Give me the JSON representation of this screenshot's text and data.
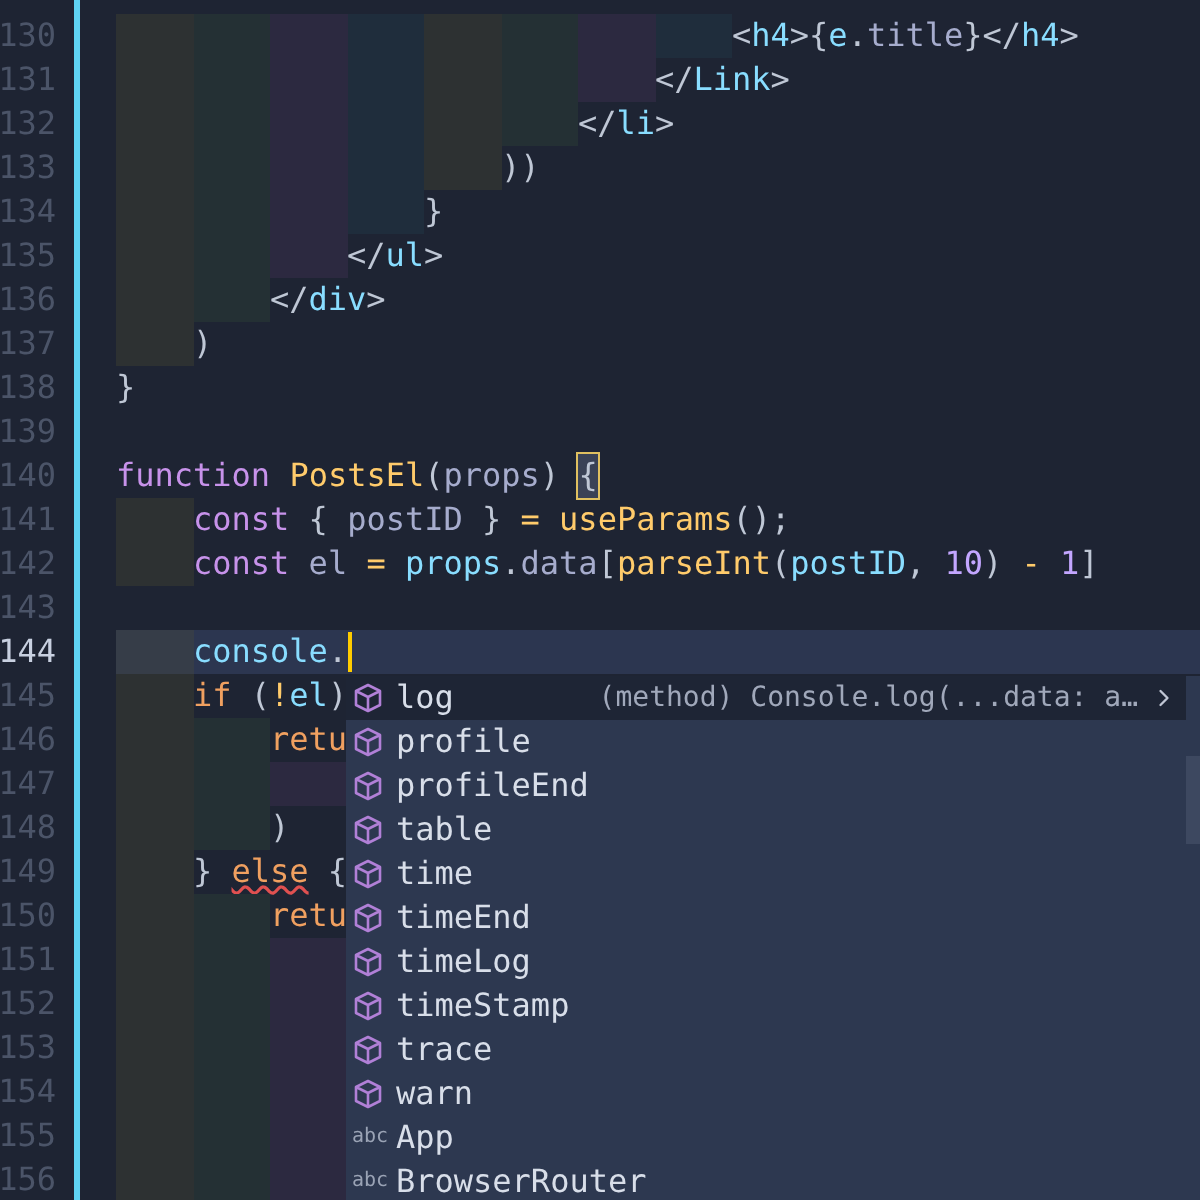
{
  "editor": {
    "lines": [
      {
        "number": "130",
        "guides": [
          {
            "color": "#2d3132"
          },
          {
            "color": "#243034"
          },
          {
            "color": "#2c2940"
          },
          {
            "color": "#1f2d3c"
          },
          {
            "color": "#2d3132"
          },
          {
            "color": "#243034"
          },
          {
            "color": "#2c2940"
          },
          {
            "color": "#1f2d3c"
          }
        ],
        "tokens": [
          {
            "kind": "punc",
            "text": "<"
          },
          {
            "kind": "tag",
            "text": "h4"
          },
          {
            "kind": "punc",
            "text": ">{"
          },
          {
            "kind": "var",
            "text": "e"
          },
          {
            "kind": "punc",
            "text": "."
          },
          {
            "kind": "prop",
            "text": "title"
          },
          {
            "kind": "punc",
            "text": "}</"
          },
          {
            "kind": "tag",
            "text": "h4"
          },
          {
            "kind": "punc",
            "text": ">"
          }
        ]
      },
      {
        "number": "131",
        "guides": [
          {
            "color": "#2d3132"
          },
          {
            "color": "#243034"
          },
          {
            "color": "#2c2940"
          },
          {
            "color": "#1f2d3c"
          },
          {
            "color": "#2d3132"
          },
          {
            "color": "#243034"
          },
          {
            "color": "#2c2940"
          }
        ],
        "tokens": [
          {
            "kind": "punc",
            "text": "</"
          },
          {
            "kind": "tag",
            "text": "Link"
          },
          {
            "kind": "punc",
            "text": ">"
          }
        ]
      },
      {
        "number": "132",
        "guides": [
          {
            "color": "#2d3132"
          },
          {
            "color": "#243034"
          },
          {
            "color": "#2c2940"
          },
          {
            "color": "#1f2d3c"
          },
          {
            "color": "#2d3132"
          },
          {
            "color": "#243034"
          }
        ],
        "tokens": [
          {
            "kind": "punc",
            "text": "</"
          },
          {
            "kind": "tag",
            "text": "li"
          },
          {
            "kind": "punc",
            "text": ">"
          }
        ]
      },
      {
        "number": "133",
        "guides": [
          {
            "color": "#2d3132"
          },
          {
            "color": "#243034"
          },
          {
            "color": "#2c2940"
          },
          {
            "color": "#1f2d3c"
          },
          {
            "color": "#2d3132"
          }
        ],
        "tokens": [
          {
            "kind": "punc",
            "text": "))"
          }
        ]
      },
      {
        "number": "134",
        "guides": [
          {
            "color": "#2d3132"
          },
          {
            "color": "#243034"
          },
          {
            "color": "#2c2940"
          },
          {
            "color": "#1f2d3c"
          }
        ],
        "tokens": [
          {
            "kind": "punc",
            "text": "}"
          }
        ]
      },
      {
        "number": "135",
        "guides": [
          {
            "color": "#2d3132"
          },
          {
            "color": "#243034"
          },
          {
            "color": "#2c2940"
          }
        ],
        "tokens": [
          {
            "kind": "punc",
            "text": "</"
          },
          {
            "kind": "tag",
            "text": "ul"
          },
          {
            "kind": "punc",
            "text": ">"
          }
        ]
      },
      {
        "number": "136",
        "guides": [
          {
            "color": "#2d3132"
          },
          {
            "color": "#243034"
          }
        ],
        "tokens": [
          {
            "kind": "punc",
            "text": "</"
          },
          {
            "kind": "tag",
            "text": "div"
          },
          {
            "kind": "punc",
            "text": ">"
          }
        ]
      },
      {
        "number": "137",
        "guides": [
          {
            "color": "#2d3132"
          }
        ],
        "tokens": [
          {
            "kind": "punc",
            "text": ")"
          }
        ]
      },
      {
        "number": "138",
        "tokens": [
          {
            "kind": "punc",
            "text": "}"
          }
        ]
      },
      {
        "number": "139"
      },
      {
        "number": "140",
        "tokens": [
          {
            "kind": "kw",
            "text": "function"
          },
          {
            "kind": "fn",
            "text": " PostsEl"
          },
          {
            "kind": "punc",
            "text": "("
          },
          {
            "kind": "prop",
            "text": "props"
          },
          {
            "kind": "punc",
            "text": ") "
          },
          {
            "kind": "punc",
            "text": "{",
            "matched": true
          }
        ]
      },
      {
        "number": "141",
        "guides": [
          {
            "color": "#2d3132"
          }
        ],
        "tokens": [
          {
            "kind": "kw",
            "text": "const"
          },
          {
            "kind": "punc",
            "text": " { "
          },
          {
            "kind": "prop",
            "text": "postID"
          },
          {
            "kind": "punc",
            "text": " } "
          },
          {
            "kind": "op",
            "text": "= "
          },
          {
            "kind": "fn",
            "text": "useParams"
          },
          {
            "kind": "punc",
            "text": "();"
          }
        ]
      },
      {
        "number": "142",
        "guides": [
          {
            "color": "#2d3132"
          }
        ],
        "tokens": [
          {
            "kind": "kw",
            "text": "const"
          },
          {
            "kind": "prop",
            "text": " el "
          },
          {
            "kind": "op",
            "text": "= "
          },
          {
            "kind": "var",
            "text": "props"
          },
          {
            "kind": "punc",
            "text": "."
          },
          {
            "kind": "prop",
            "text": "data"
          },
          {
            "kind": "punc",
            "text": "["
          },
          {
            "kind": "fn",
            "text": "parseInt"
          },
          {
            "kind": "punc",
            "text": "("
          },
          {
            "kind": "var",
            "text": "postID"
          },
          {
            "kind": "punc",
            "text": ", "
          },
          {
            "kind": "num",
            "text": "10"
          },
          {
            "kind": "punc",
            "text": ") "
          },
          {
            "kind": "op",
            "text": "- "
          },
          {
            "kind": "num",
            "text": "1"
          },
          {
            "kind": "punc",
            "text": "]"
          }
        ]
      },
      {
        "number": "143"
      },
      {
        "number": "144",
        "current": true,
        "cursor": true,
        "guides": [
          {
            "color": "#363d48"
          }
        ],
        "tokens": [
          {
            "kind": "var",
            "text": "console"
          },
          {
            "kind": "punc",
            "text": "."
          }
        ]
      },
      {
        "number": "145",
        "guides": [
          {
            "color": "#2d3132"
          }
        ],
        "tokens": [
          {
            "kind": "ctrl",
            "text": "if"
          },
          {
            "kind": "punc",
            "text": " ("
          },
          {
            "kind": "op",
            "text": "!"
          },
          {
            "kind": "var",
            "text": "el"
          },
          {
            "kind": "punc",
            "text": ")"
          }
        ]
      },
      {
        "number": "146",
        "guides": [
          {
            "color": "#2d3132"
          },
          {
            "color": "#243034"
          }
        ],
        "tokens": [
          {
            "kind": "ctrl",
            "text": "retu"
          }
        ]
      },
      {
        "number": "147",
        "guides": [
          {
            "color": "#2d3132"
          },
          {
            "color": "#243034"
          },
          {
            "color": "#2c2940"
          }
        ]
      },
      {
        "number": "148",
        "guides": [
          {
            "color": "#2d3132"
          },
          {
            "color": "#243034"
          }
        ],
        "tokens": [
          {
            "kind": "punc",
            "text": ")"
          }
        ]
      },
      {
        "number": "149",
        "guides": [
          {
            "color": "#2d3132"
          }
        ],
        "tokens": [
          {
            "kind": "punc",
            "text": "} "
          },
          {
            "kind": "ctrl",
            "text": "else",
            "squiggle": true
          },
          {
            "kind": "punc",
            "text": " {"
          }
        ]
      },
      {
        "number": "150",
        "guides": [
          {
            "color": "#2d3132"
          },
          {
            "color": "#243034"
          }
        ],
        "tokens": [
          {
            "kind": "ctrl",
            "text": "retu"
          }
        ]
      },
      {
        "number": "151",
        "guides": [
          {
            "color": "#2d3132"
          },
          {
            "color": "#243034"
          },
          {
            "color": "#2c2940"
          }
        ]
      },
      {
        "number": "152",
        "guides": [
          {
            "color": "#2d3132"
          },
          {
            "color": "#243034"
          },
          {
            "color": "#2c2940"
          }
        ]
      },
      {
        "number": "153",
        "guides": [
          {
            "color": "#2d3132"
          },
          {
            "color": "#243034"
          },
          {
            "color": "#2c2940"
          }
        ]
      },
      {
        "number": "154",
        "guides": [
          {
            "color": "#2d3132"
          },
          {
            "color": "#243034"
          },
          {
            "color": "#2c2940"
          }
        ]
      },
      {
        "number": "155",
        "guides": [
          {
            "color": "#2d3132"
          },
          {
            "color": "#243034"
          },
          {
            "color": "#2c2940"
          }
        ]
      },
      {
        "number": "156",
        "guides": [
          {
            "color": "#2d3132"
          },
          {
            "color": "#243034"
          },
          {
            "color": "#2c2940"
          }
        ]
      }
    ]
  },
  "suggestions": {
    "items": [
      {
        "kind": "method",
        "label": "log",
        "selected": true,
        "detail": "(method) Console.log(...data: a…"
      },
      {
        "kind": "method",
        "label": "profile",
        "selected": false
      },
      {
        "kind": "method",
        "label": "profileEnd",
        "selected": false
      },
      {
        "kind": "method",
        "label": "table",
        "selected": false
      },
      {
        "kind": "method",
        "label": "time",
        "selected": false
      },
      {
        "kind": "method",
        "label": "timeEnd",
        "selected": false
      },
      {
        "kind": "method",
        "label": "timeLog",
        "selected": false
      },
      {
        "kind": "method",
        "label": "timeStamp",
        "selected": false
      },
      {
        "kind": "method",
        "label": "trace",
        "selected": false
      },
      {
        "kind": "method",
        "label": "warn",
        "selected": false
      },
      {
        "kind": "text",
        "label": "App",
        "selected": false,
        "icon_text": "abc"
      },
      {
        "kind": "text",
        "label": "BrowserRouter",
        "selected": false,
        "icon_text": "abc"
      }
    ]
  }
}
